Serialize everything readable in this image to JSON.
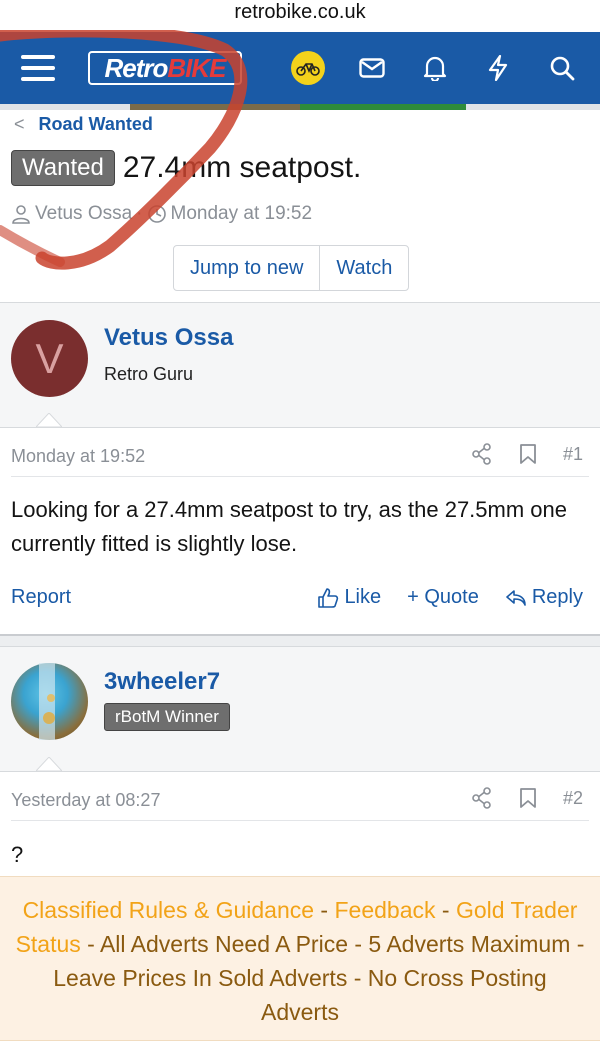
{
  "browser": {
    "url": "retrobike.co.uk"
  },
  "nav": {
    "logo_part1": "RetroBIKE",
    "logo_retro": "Retro",
    "logo_bike": "BIKE"
  },
  "thread": {
    "breadcrumb": "Road Wanted",
    "prefix": "Wanted",
    "title": "27.4mm seatpost.",
    "author": "Vetus Ossa",
    "date": "Monday at 19:52",
    "jump_label": "Jump to new",
    "watch_label": "Watch"
  },
  "posts": [
    {
      "username": "Vetus Ossa",
      "user_title": "Retro Guru",
      "avatar_letter": "V",
      "avatar_color": "#7a2e2e",
      "date": "Monday at 19:52",
      "number": "#1",
      "body": "Looking for a 27.4mm seatpost to try, as the 27.5mm one currently fitted is slightly lose.",
      "report": "Report",
      "like": "Like",
      "quote": "+ Quote",
      "reply": "Reply"
    },
    {
      "username": "3wheeler7",
      "user_badge": "rBotM Winner",
      "date": "Yesterday at 08:27",
      "number": "#2",
      "body": "?"
    }
  ],
  "notice": {
    "link1": "Classified Rules & Guidance",
    "sep1": " - ",
    "link2": "Feedback",
    "sep2": " - ",
    "link3": "Gold Trader Status",
    "text": " - All Adverts Need A Price - 5 Adverts Maximum - Leave Prices In Sold Adverts - No Cross Posting Adverts"
  },
  "colors": {
    "nav": "#1a5aa6",
    "link": "#1a5aa6",
    "notice_bg": "#fdf1e3",
    "notice_link": "#f2a318",
    "annotation": "#c9432e"
  }
}
